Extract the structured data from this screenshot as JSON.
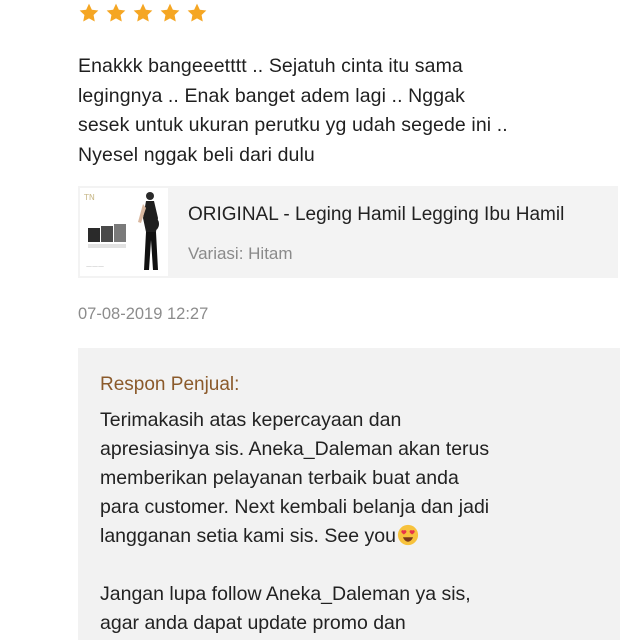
{
  "review": {
    "rating": 5,
    "star_color": "#f5a623",
    "text_lines": [
      "Enakkk bangeeetttt .. Sejatuh cinta itu sama",
      "legingnya .. Enak banget adem lagi .. Nggak",
      "sesek untuk ukuran perutku yg udah segede ini ..",
      "Nyesel nggak beli dari dulu"
    ],
    "timestamp": "07-08-2019 12:27"
  },
  "product": {
    "name": "ORIGINAL - Leging Hamil Legging Ibu Hamil",
    "variation": "Variasi: Hitam",
    "thumbnail_icon": "product-thumbnail"
  },
  "seller_response": {
    "label": "Respon Penjual:",
    "label_color": "#8b5a2b",
    "paragraph1_lines": [
      "Terimakasih atas kepercayaan dan",
      "apresiasinya sis. Aneka_Daleman akan terus",
      "memberikan pelayanan terbaik buat anda",
      "para customer. Next kembali belanja dan jadi",
      "langganan setia kami sis. See you"
    ],
    "emoji": "smiling-face-with-heart-eyes",
    "paragraph2_lines": [
      "Jangan lupa follow Aneka_Daleman ya sis,",
      "agar anda dapat update promo dan"
    ]
  }
}
